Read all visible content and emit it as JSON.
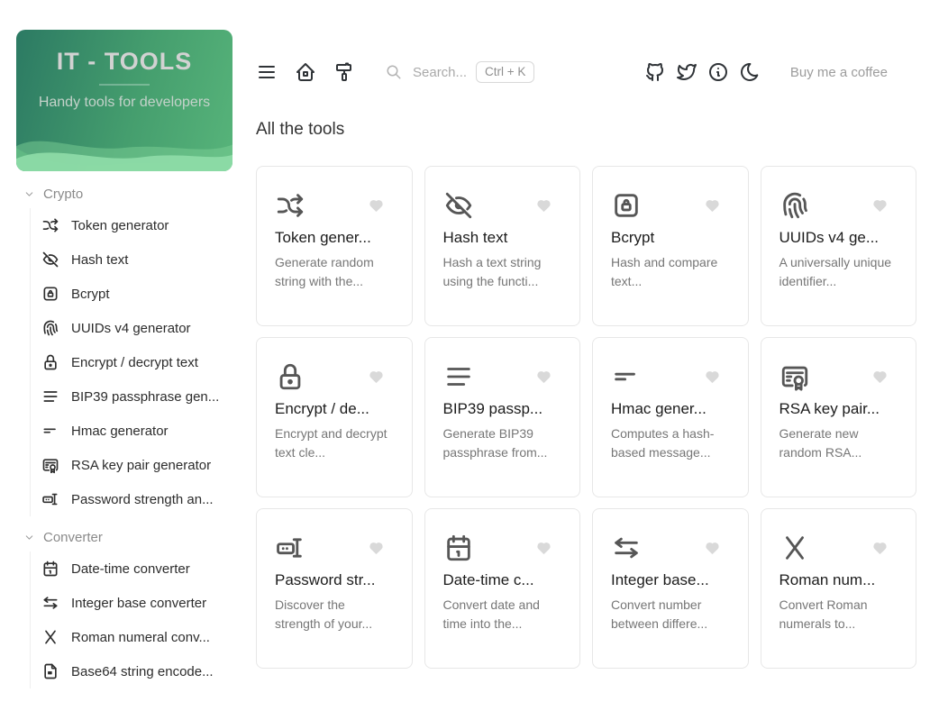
{
  "sidebar": {
    "logo": {
      "title": "IT - TOOLS",
      "subtitle": "Handy tools for developers"
    },
    "sections": [
      {
        "label": "Crypto",
        "items": [
          {
            "label": "Token generator",
            "icon": "shuffle-icon"
          },
          {
            "label": "Hash text",
            "icon": "eye-off-icon"
          },
          {
            "label": "Bcrypt",
            "icon": "lock-square-icon"
          },
          {
            "label": "UUIDs v4 generator",
            "icon": "fingerprint-icon"
          },
          {
            "label": "Encrypt / decrypt text",
            "icon": "lock-icon"
          },
          {
            "label": "BIP39 passphrase gen...",
            "icon": "align-left-icon"
          },
          {
            "label": "Hmac generator",
            "icon": "short-lines-icon"
          },
          {
            "label": "RSA key pair generator",
            "icon": "certificate-icon"
          },
          {
            "label": "Password strength an...",
            "icon": "password-meter-icon"
          }
        ]
      },
      {
        "label": "Converter",
        "items": [
          {
            "label": "Date-time converter",
            "icon": "calendar-icon"
          },
          {
            "label": "Integer base converter",
            "icon": "arrows-left-right-icon"
          },
          {
            "label": "Roman numeral conv...",
            "icon": "letter-x-icon"
          },
          {
            "label": "Base64 string encode...",
            "icon": "file-base64-icon"
          }
        ]
      }
    ]
  },
  "topbar": {
    "search_placeholder": "Search...",
    "search_shortcut": "Ctrl + K",
    "coffee_label": "Buy me a coffee"
  },
  "main": {
    "heading": "All the tools",
    "cards": [
      {
        "title": "Token gener...",
        "description": "Generate random string with the...",
        "icon": "shuffle-icon"
      },
      {
        "title": "Hash text",
        "description": "Hash a text string using the functi...",
        "icon": "eye-off-icon"
      },
      {
        "title": "Bcrypt",
        "description": "Hash and compare text...",
        "icon": "lock-square-icon"
      },
      {
        "title": "UUIDs v4 ge...",
        "description": "A universally unique identifier...",
        "icon": "fingerprint-icon"
      },
      {
        "title": "Encrypt / de...",
        "description": "Encrypt and decrypt text cle...",
        "icon": "lock-icon"
      },
      {
        "title": "BIP39 passp...",
        "description": "Generate BIP39 passphrase from...",
        "icon": "align-left-icon"
      },
      {
        "title": "Hmac gener...",
        "description": "Computes a hash-based message...",
        "icon": "short-lines-icon"
      },
      {
        "title": "RSA key pair...",
        "description": "Generate new random RSA...",
        "icon": "certificate-icon"
      },
      {
        "title": "Password str...",
        "description": "Discover the strength of your...",
        "icon": "password-meter-icon"
      },
      {
        "title": "Date-time c...",
        "description": "Convert date and time into the...",
        "icon": "calendar-icon"
      },
      {
        "title": "Integer base...",
        "description": "Convert number between differe...",
        "icon": "arrows-left-right-icon"
      },
      {
        "title": "Roman num...",
        "description": "Convert Roman numerals to...",
        "icon": "letter-x-icon"
      }
    ]
  },
  "colors": {
    "logo_gradient_start": "#2c7a63",
    "logo_gradient_end": "#57b47a",
    "card_border": "#e7e7e7",
    "heart": "#d9d9d9"
  }
}
